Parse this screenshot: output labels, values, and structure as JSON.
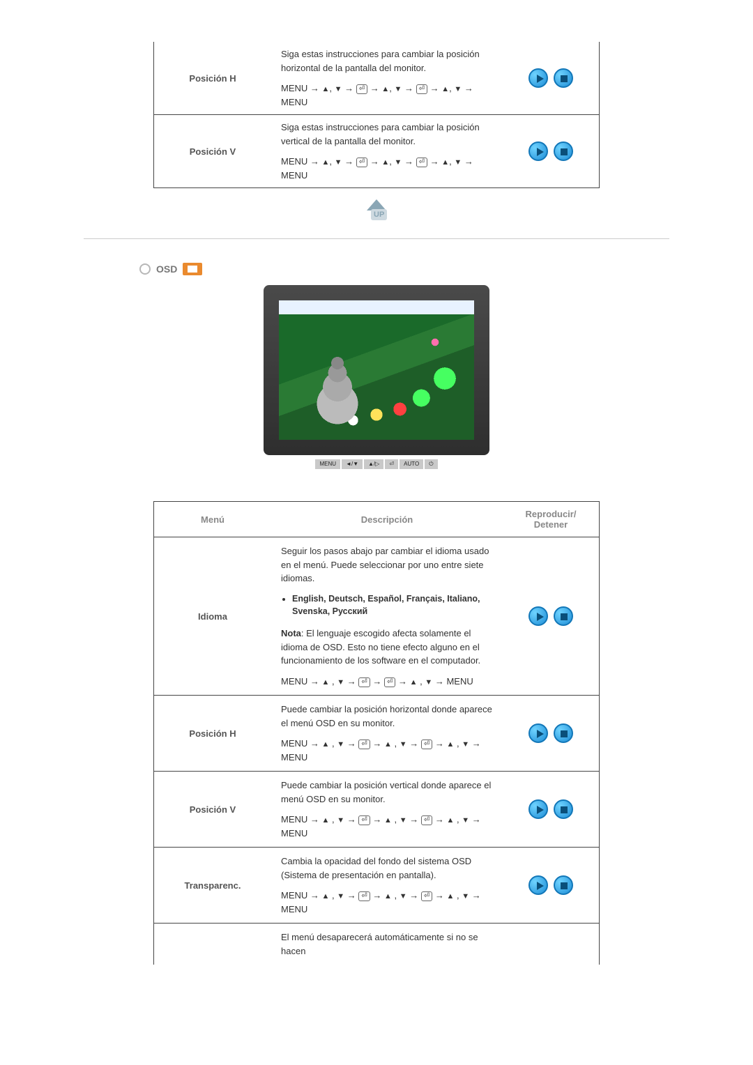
{
  "top_table": {
    "rows": [
      {
        "label": "Posición H",
        "line1": "Siga estas instrucciones para cambiar la posición horizontal de la pantalla del monitor.",
        "nav_prefix": "MENU → ",
        "nav_suffix": " → MENU"
      },
      {
        "label": "Posición V",
        "line1": "Siga estas instrucciones para cambiar la posición vertical de la pantalla del monitor.",
        "nav_prefix": "MENU → ",
        "nav_suffix": " → MENU"
      }
    ]
  },
  "section": {
    "title": "OSD"
  },
  "monitor_buttons": [
    "MENU",
    "◄/▼",
    "▲/▷",
    "⏎",
    "AUTO",
    "⏻"
  ],
  "table2": {
    "head": {
      "menu": "Menú",
      "desc": "Descripción",
      "play": "Reproducir/ Detener"
    },
    "rows": [
      {
        "label": "Idioma",
        "p1": "Seguir los pasos abajo par cambiar el idioma usado en el menú. Puede seleccionar por uno entre siete idiomas.",
        "langs": "English, Deutsch, Español, Français, Italiano, Svenska, Русский",
        "note_label": "Nota",
        "note": ": El lenguaje escogido afecta solamente el idioma de OSD. Esto no tiene efecto alguno en el funcionamiento de los software en el computador.",
        "nav_prefix": "MENU → ",
        "nav_suffix": " → MENU"
      },
      {
        "label": "Posición H",
        "p1": "Puede cambiar la posición horizontal donde aparece el menú OSD en su monitor.",
        "nav_prefix": "MENU → ",
        "nav_suffix": " → MENU"
      },
      {
        "label": "Posición V",
        "p1": "Puede cambiar la posición vertical donde aparece el menú OSD en su monitor.",
        "nav_prefix": "MENU → ",
        "nav_suffix": " → MENU"
      },
      {
        "label": "Transparenc.",
        "p1": "Cambia la opacidad del fondo del sistema OSD (Sistema de presentación en pantalla).",
        "nav_prefix": "MENU → ",
        "nav_suffix": " → MENU"
      }
    ],
    "tail": "El menú desaparecerá automáticamente si no se hacen"
  }
}
